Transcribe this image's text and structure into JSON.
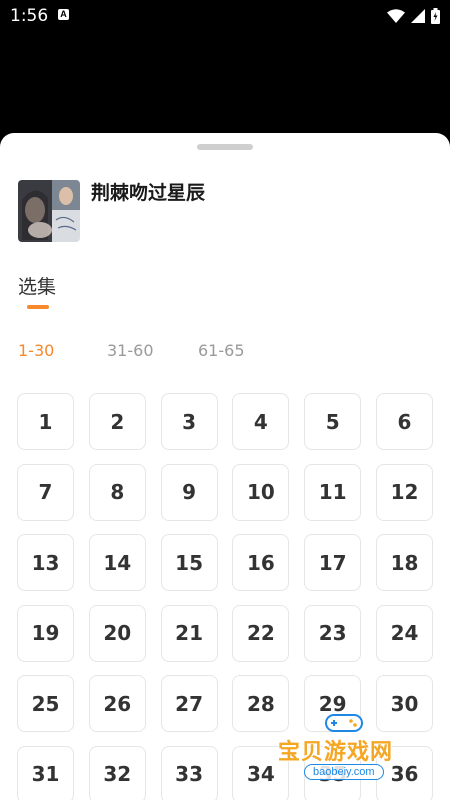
{
  "status_bar": {
    "time": "1:56",
    "notification_icon": "a-icon",
    "icons": [
      "wifi-icon",
      "signal-icon",
      "battery-icon"
    ]
  },
  "show": {
    "title": "荆棘吻过星辰"
  },
  "episode_selector": {
    "label": "选集",
    "ranges": [
      "1-30",
      "31-60",
      "61-65"
    ],
    "active_range": "1-30",
    "episodes": [
      "1",
      "2",
      "3",
      "4",
      "5",
      "6",
      "7",
      "8",
      "9",
      "10",
      "11",
      "12",
      "13",
      "14",
      "15",
      "16",
      "17",
      "18",
      "19",
      "20",
      "21",
      "22",
      "23",
      "24",
      "25",
      "26",
      "27",
      "28",
      "29",
      "30",
      "31",
      "32",
      "33",
      "34",
      "35",
      "36"
    ]
  },
  "watermark": {
    "text": "宝贝游戏网",
    "url": "baobeiy.com"
  },
  "colors": {
    "accent": "#f7892c",
    "inactive_tab": "#9a9a9a",
    "episode_border": "#e6e6e6",
    "backdrop": "#000000"
  }
}
